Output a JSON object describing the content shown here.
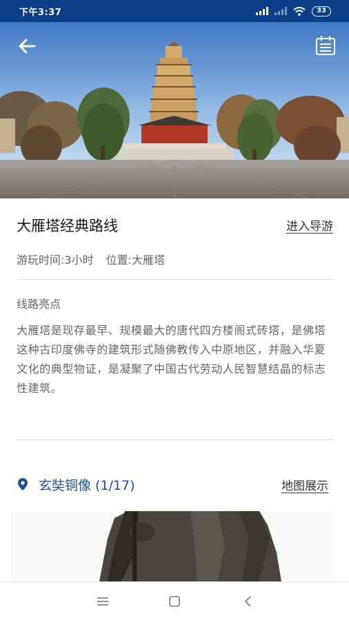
{
  "status_bar": {
    "time": "下午3:37",
    "battery": "33"
  },
  "header": {
    "back_icon": "arrow-left-icon",
    "menu_icon": "document-list-icon"
  },
  "route": {
    "title": "大雁塔经典路线",
    "enter_guide_label": "进入导游",
    "play_time": "游玩时间:3小时",
    "location": "位置:大雁塔",
    "highlights_label": "线路亮点",
    "description": "大雁塔是现存最早、规模最大的唐代四方楼阁式砖塔，是佛塔这种古印度佛寺的建筑形式随佛教传入中原地区，并融入华夏文化的典型物证，是凝聚了中国古代劳动人民智慧结晶的标志性建筑。"
  },
  "point": {
    "name": "玄奘铜像 (1/17)",
    "map_label": "地图展示",
    "icon": "location-pin-icon"
  },
  "nav": {
    "menu_icon": "menu-lines-icon",
    "home_icon": "square-home-icon",
    "back_icon": "chevron-left-icon"
  },
  "colors": {
    "status_bar": "#0b3e86",
    "accent": "#1d4f91"
  }
}
